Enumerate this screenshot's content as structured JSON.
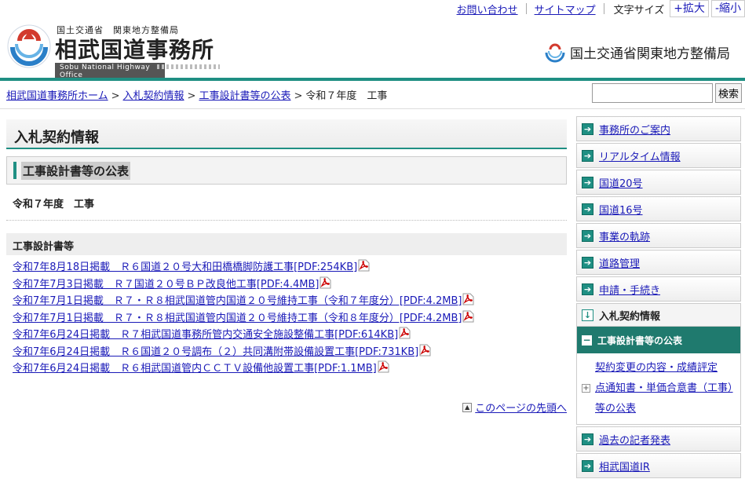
{
  "utility": {
    "contact": "お問い合わせ",
    "sitemap": "サイトマップ",
    "font_size_label": "文字サイズ",
    "enlarge": "+拡大",
    "shrink": "-縮小"
  },
  "header": {
    "ministry_small": "国土交通省　関東地方整備局",
    "office_name": "相武国道事務所",
    "office_name_en": "Sobu National Highway Office",
    "ministry_right": "国土交通省関東地方整備局"
  },
  "breadcrumb": {
    "home": "相武国道事務所ホーム",
    "level1": "入札契約情報",
    "level2": "工事設計書等の公表",
    "current": "令和７年度　工事",
    "separator": ">"
  },
  "search": {
    "value": "",
    "button_label": "検索"
  },
  "main": {
    "title": "入札契約情報",
    "section_title": "工事設計書等の公表",
    "year_heading": "令和７年度　工事",
    "list_heading": "工事設計書等",
    "documents": [
      "令和7年8月18日掲載　Ｒ６国道２０号大和田橋橋脚防護工事[PDF:254KB]",
      "令和7年7月3日掲載　Ｒ７国道２０号ＢＰ改良他工事[PDF:4.4MB]",
      "令和7年7月1日掲載　Ｒ７・Ｒ８相武国道管内国道２０号維持工事（令和７年度分）[PDF:4.2MB]",
      "令和7年7月1日掲載　Ｒ７・Ｒ８相武国道管内国道２０号維持工事（令和８年度分）[PDF:4.2MB]",
      "令和7年6月24日掲載　Ｒ７相武国道事務所管内交通安全施設整備工事[PDF:614KB]",
      "令和7年6月24日掲載　Ｒ６国道２０号調布（２）共同溝附帯設備設置工事[PDF:731KB]",
      "令和7年6月24日掲載　Ｒ６相武国道管内ＣＣＴＶ設備他設置工事[PDF:1.1MB]"
    ],
    "back_to_top": "このページの先頭へ"
  },
  "sidebar": {
    "items_top": [
      "事務所のご案内",
      "リアルタイム情報",
      "国道20号",
      "国道16号",
      "事業の軌跡",
      "道路管理",
      "申請・手続き"
    ],
    "active_item": "入札契約情報",
    "active_sub": "工事設計書等の公表",
    "sub_items": [
      "契約変更の内容・成績評定",
      "点通知書・単価合意書（工事）等の公表"
    ],
    "items_bottom": [
      "過去の記者発表",
      "相武国道IR"
    ]
  },
  "colors": {
    "brand_teal": "#1f8f83",
    "link_blue": "#1a1ab8",
    "active_sub_bg": "#1f7a6e",
    "pdf_red": "#cc0000"
  }
}
